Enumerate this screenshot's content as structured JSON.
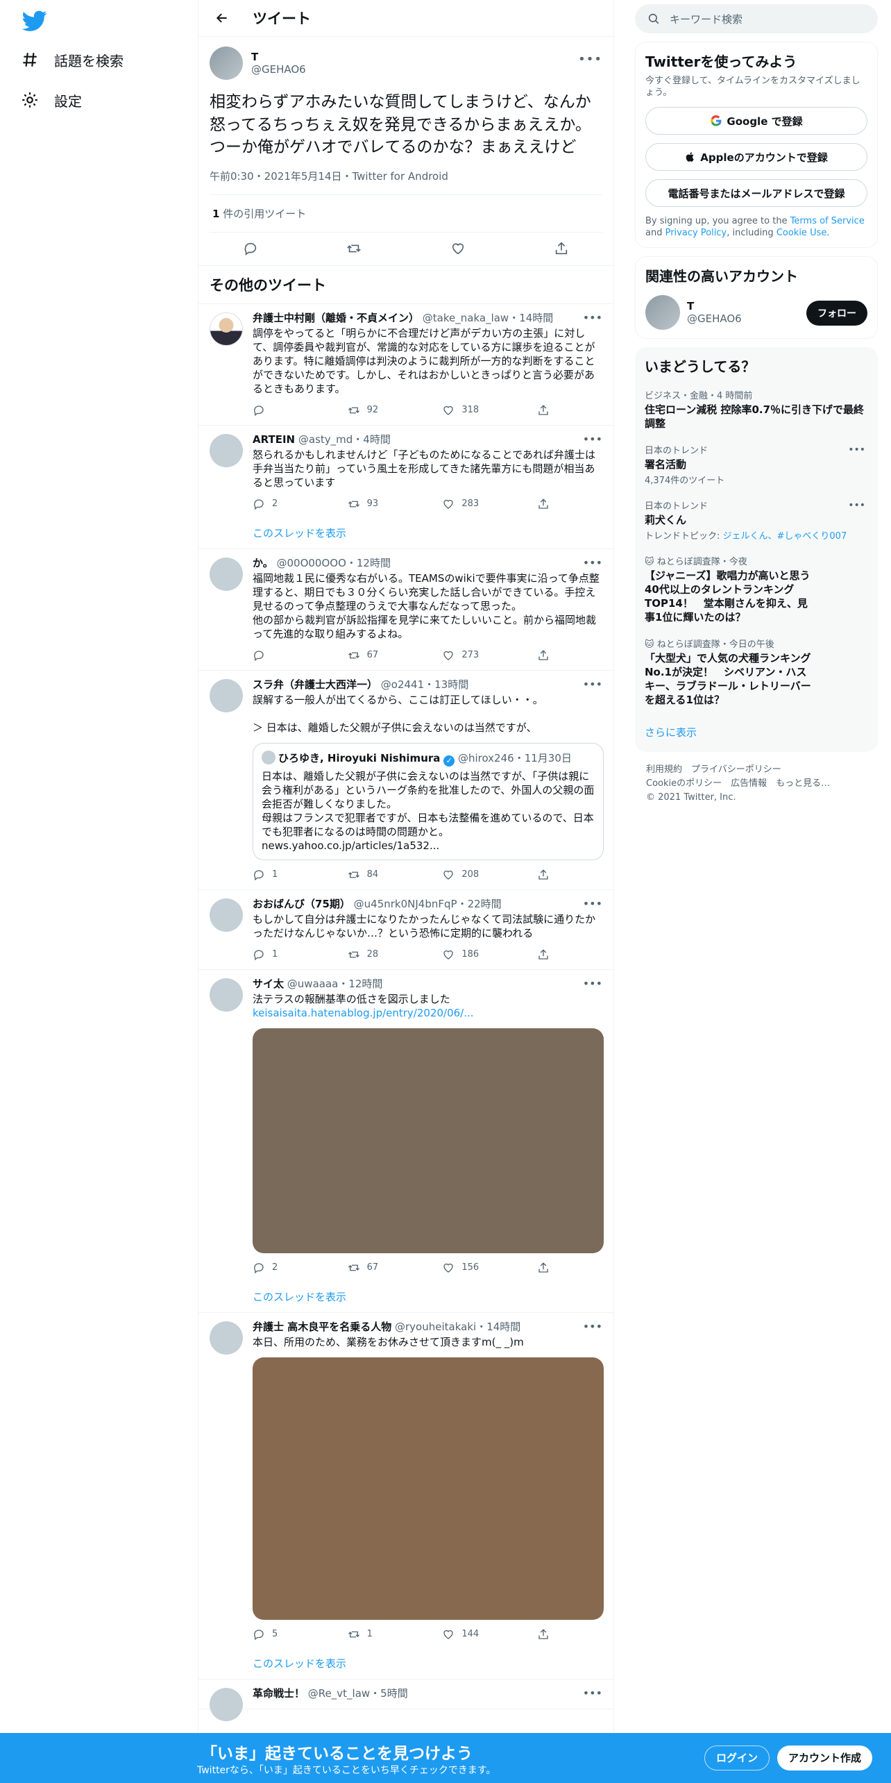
{
  "nav": {
    "explore_label": "話題を検索",
    "settings_label": "設定"
  },
  "header": {
    "title": "ツイート"
  },
  "focus_tweet": {
    "name": "T",
    "handle": "@GEHAO6",
    "text": "相変わらずアホみたいな質問してしまうけど、なんか怒ってるちっちぇえ奴を発見できるからまぁええか。つーか俺がゲハオでバレてるのかな？まぁええけど",
    "meta": "午前0:30・2021年5月14日・Twitter for Android",
    "quote_count": "1",
    "quote_label": " 件の引用ツイート"
  },
  "more_tweets_title": "その他のツイート",
  "thread_link_label": "このスレッドを表示",
  "tweets": [
    {
      "name": "弁護士中村剛（離婚・不貞メイン）",
      "handle": "@take_naka_law",
      "time": "・14時間",
      "text": "調停をやってると「明らかに不合理だけど声がデカい方の主張」に対して、調停委員や裁判官が、常識的な対応をしている方に譲歩を迫ることがあります。特に離婚調停は判決のように裁判所が一方的な判断をすることができないためです。しかし、それはおかしいときっぱりと言う必要があるときもあります。",
      "reply": "",
      "retweet": "92",
      "like": "318"
    },
    {
      "name": "ARTEIN",
      "handle": "@asty_md",
      "time": "・4時間",
      "text": "怒られるかもしれませんけど「子どものためになることであれば弁護士は手弁当当たり前」っていう風土を形成してきた諸先輩方にも問題が相当あると思っています",
      "reply": "2",
      "retweet": "93",
      "like": "283"
    },
    {
      "name": "か。",
      "handle": "@00O00OOO",
      "time": "・12時間",
      "text": "福岡地裁１民に優秀な右がいる。TEAMSのwikiで要件事実に沿って争点整理すると、期日でも３０分くらい充実した話し合いができている。手控え見せるのって争点整理のうえで大事なんだなって思った。\n他の部から裁判官が訴訟指揮を見学に来てたしいいこと。前から福岡地裁って先進的な取り組みするよね。",
      "reply": "",
      "retweet": "67",
      "like": "273"
    },
    {
      "name": "スラ弁（弁護士大西洋一）",
      "handle": "@o2441",
      "time": "・13時間",
      "text": "誤解する一般人が出てくるから、ここは訂正してほしい・・。\n\n＞ 日本は、離婚した父親が子供に会えないのは当然ですが、",
      "quote": {
        "name": "ひろゆき, Hiroyuki Nishimura",
        "handle": "@hirox246",
        "time": "・11月30日",
        "text": "日本は、離婚した父親が子供に会えないのは当然ですが、「子供は親に会う権利がある」というハーグ条約を批准したので、外国人の父親の面会拒否が難しくなりました。\n母親はフランスで犯罪者ですが、日本も法整備を進めているので、日本でも犯罪者になるのは時間の問題かと。\nnews.yahoo.co.jp/articles/1a532..."
      },
      "reply": "1",
      "retweet": "84",
      "like": "208"
    },
    {
      "name": "おおばんび（75期）",
      "handle": "@u45nrk0NJ4bnFqP",
      "time": "・22時間",
      "text": "もしかして自分は弁護士になりたかったんじゃなくて司法試験に通りたかっただけなんじゃないか…？という恐怖に定期的に襲われる",
      "reply": "1",
      "retweet": "28",
      "like": "186"
    },
    {
      "name": "サイ太",
      "handle": "@uwaaaa",
      "time": "・12時間",
      "text": "法テラスの報酬基準の低さを図示しました",
      "link": "keisaisaita.hatenablog.jp/entry/2020/06/...",
      "reply": "2",
      "retweet": "67",
      "like": "156"
    },
    {
      "name": "弁護士 高木良平を名乗る人物",
      "handle": "@ryouheitakaki",
      "time": "・14時間",
      "text": "本日、所用のため、業務をお休みさせて頂きますm(_ _)m",
      "reply": "5",
      "retweet": "1",
      "like": "144"
    },
    {
      "name": "革命戦士！",
      "handle": "@Re_vt_law",
      "time": "・5時間"
    }
  ],
  "right": {
    "search_placeholder": "キーワード検索",
    "signup": {
      "title": "Twitterを使ってみよう",
      "sub": "今すぐ登録して、タイムラインをカスタマイズしましょう。",
      "google": "Google で登録",
      "apple": "Appleのアカウントで登録",
      "phone": "電話番号またはメールアドレスで登録",
      "legal_1": "By signing up, you agree to the ",
      "tos": "Terms of Service",
      "legal_2": " and ",
      "privacy": "Privacy Policy",
      "legal_3": ", including ",
      "cookie": "Cookie Use",
      "legal_4": "."
    },
    "relevant": {
      "title": "関連性の高いアカウント",
      "name": "T",
      "handle": "@GEHAO6",
      "follow": "フォロー"
    },
    "trends": {
      "title": "いまどうしてる？",
      "items": [
        {
          "ctx": "ビジネス・金融・4 時間前",
          "title": "住宅ローン減税 控除率0.7％に引き下げで最終調整"
        },
        {
          "ctx": "日本のトレンド",
          "title": "署名活動",
          "count": "4,374件のツイート"
        },
        {
          "ctx": "日本のトレンド",
          "title": "莉犬くん",
          "topic_prefix": "トレンドトピック: ",
          "topic": "ジェルくん、#しゃべくり007"
        },
        {
          "ctx": "ねとらぼ調査隊・今夜",
          "title": "【ジャニーズ】歌唱力が高いと思う40代以上のタレントランキングTOP14！　堂本剛さんを抑え、見事1位に輝いたのは？"
        },
        {
          "ctx": "ねとらぼ調査隊・今日の午後",
          "title": "「大型犬」で人気の犬種ランキングNo.1が決定！　シベリアン・ハスキー、ラブラドール・レトリーバーを超える1位は？"
        }
      ],
      "more": "さらに表示"
    },
    "footer": {
      "line1": "利用規約　プライバシーポリシー",
      "line2": "Cookieのポリシー　広告情報　もっと見る…",
      "line3": "© 2021 Twitter, Inc."
    }
  },
  "banner": {
    "headline": "「いま」起きていることを見つけよう",
    "sub": "Twitterなら、「いま」起きていることをいち早くチェックできます。",
    "login": "ログイン",
    "signup": "アカウント作成"
  },
  "colors": {
    "accent": "#1d9bf0",
    "text": "#0f1419",
    "secondary": "#536471"
  },
  "media_colors": [
    "#7a6a5a",
    "#87694f"
  ]
}
